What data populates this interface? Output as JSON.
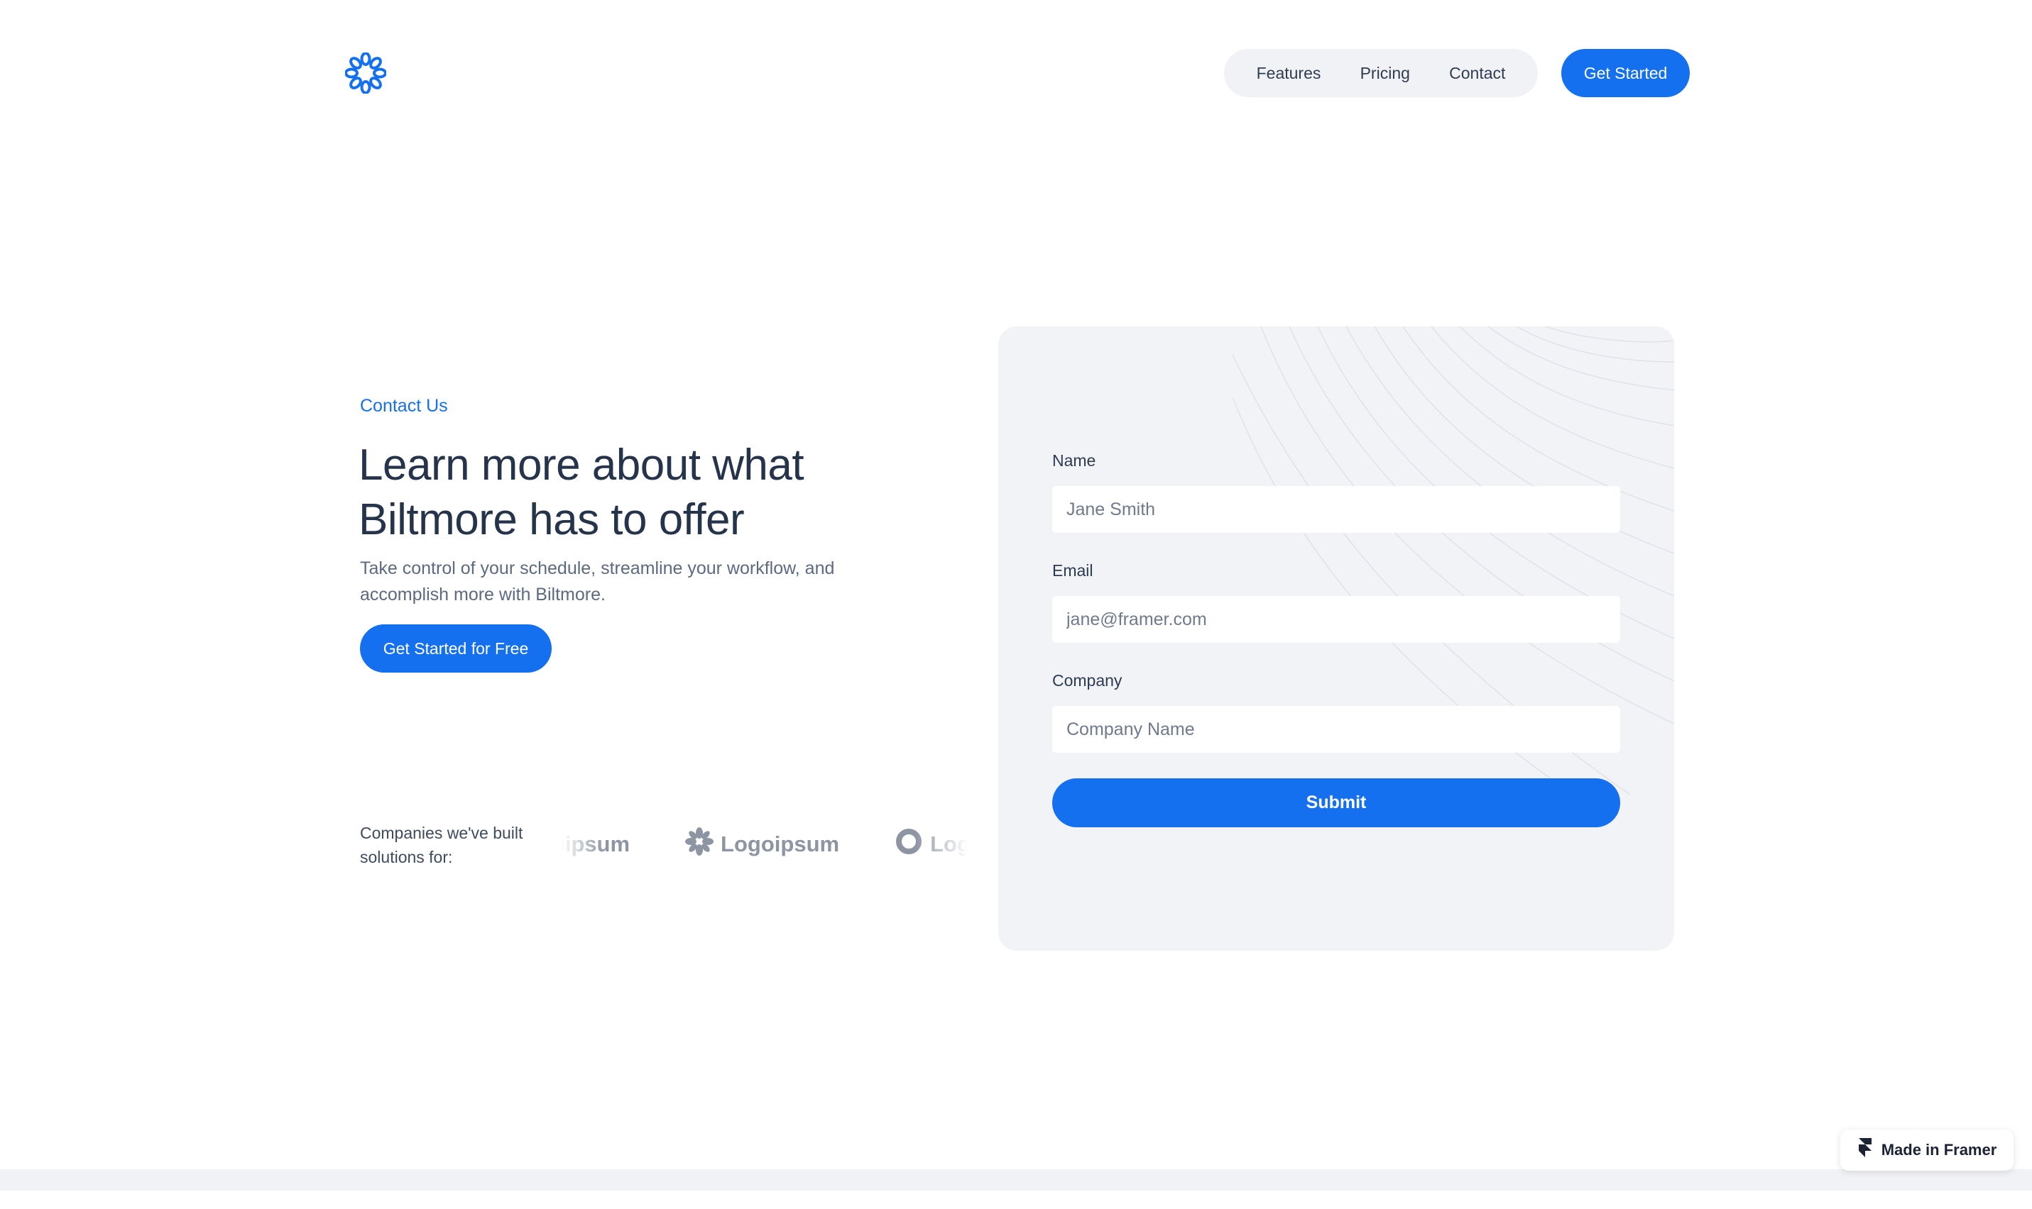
{
  "header": {
    "nav": [
      "Features",
      "Pricing",
      "Contact"
    ],
    "cta_label": "Get Started"
  },
  "hero": {
    "eyebrow": "Contact Us",
    "headline_line1": "Learn more about what",
    "headline_line2": "Biltmore has to offer",
    "subtext_line1": "Take control of your schedule, streamline your workflow, and",
    "subtext_line2": "accomplish more with Biltmore.",
    "cta_label": "Get Started for Free",
    "companies_line1": "Companies we've built",
    "companies_line2": "solutions for:",
    "client_logos": [
      "Logoipsum",
      "Logoipsum",
      "Logoipsum"
    ]
  },
  "form": {
    "name_label": "Name",
    "name_placeholder": "Jane Smith",
    "email_label": "Email",
    "email_placeholder": "jane@framer.com",
    "company_label": "Company",
    "company_placeholder": "Company Name",
    "submit_label": "Submit"
  },
  "badge": {
    "label": "Made in Framer"
  },
  "colors": {
    "accent": "#1570ef",
    "card_bg": "#f2f3f6",
    "text_dark": "#26344b",
    "logo_gray": "#8d95a3"
  },
  "icons": [
    "flower-logo-icon",
    "pinwheel-logo-icon",
    "ring-logo-icon",
    "framer-icon"
  ]
}
